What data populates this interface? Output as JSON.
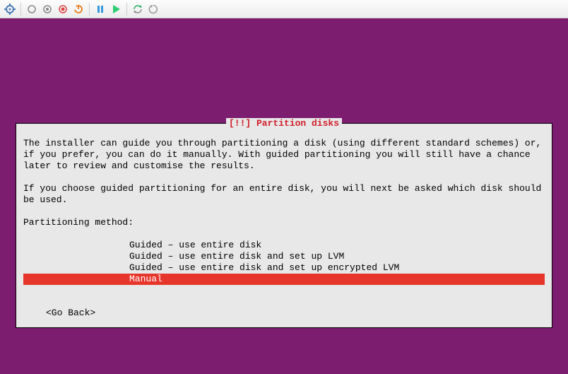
{
  "toolbar": {
    "icons": [
      "settings",
      "snapshot-ring",
      "snapshot-dot",
      "record",
      "power",
      "pause",
      "play",
      "sync",
      "restart"
    ]
  },
  "dialog": {
    "title": "[!!] Partition disks",
    "para1": "The installer can guide you through partitioning a disk (using different standard schemes) or, if you prefer, you can do it manually. With guided partitioning you will still have a chance later to review and customise the results.",
    "para2": "If you choose guided partitioning for an entire disk, you will next be asked which disk should be used.",
    "method_label": "Partitioning method:",
    "options": [
      "Guided – use entire disk",
      "Guided – use entire disk and set up LVM",
      "Guided – use entire disk and set up encrypted LVM",
      "Manual"
    ],
    "selected_index": 3,
    "go_back": "<Go Back>"
  }
}
